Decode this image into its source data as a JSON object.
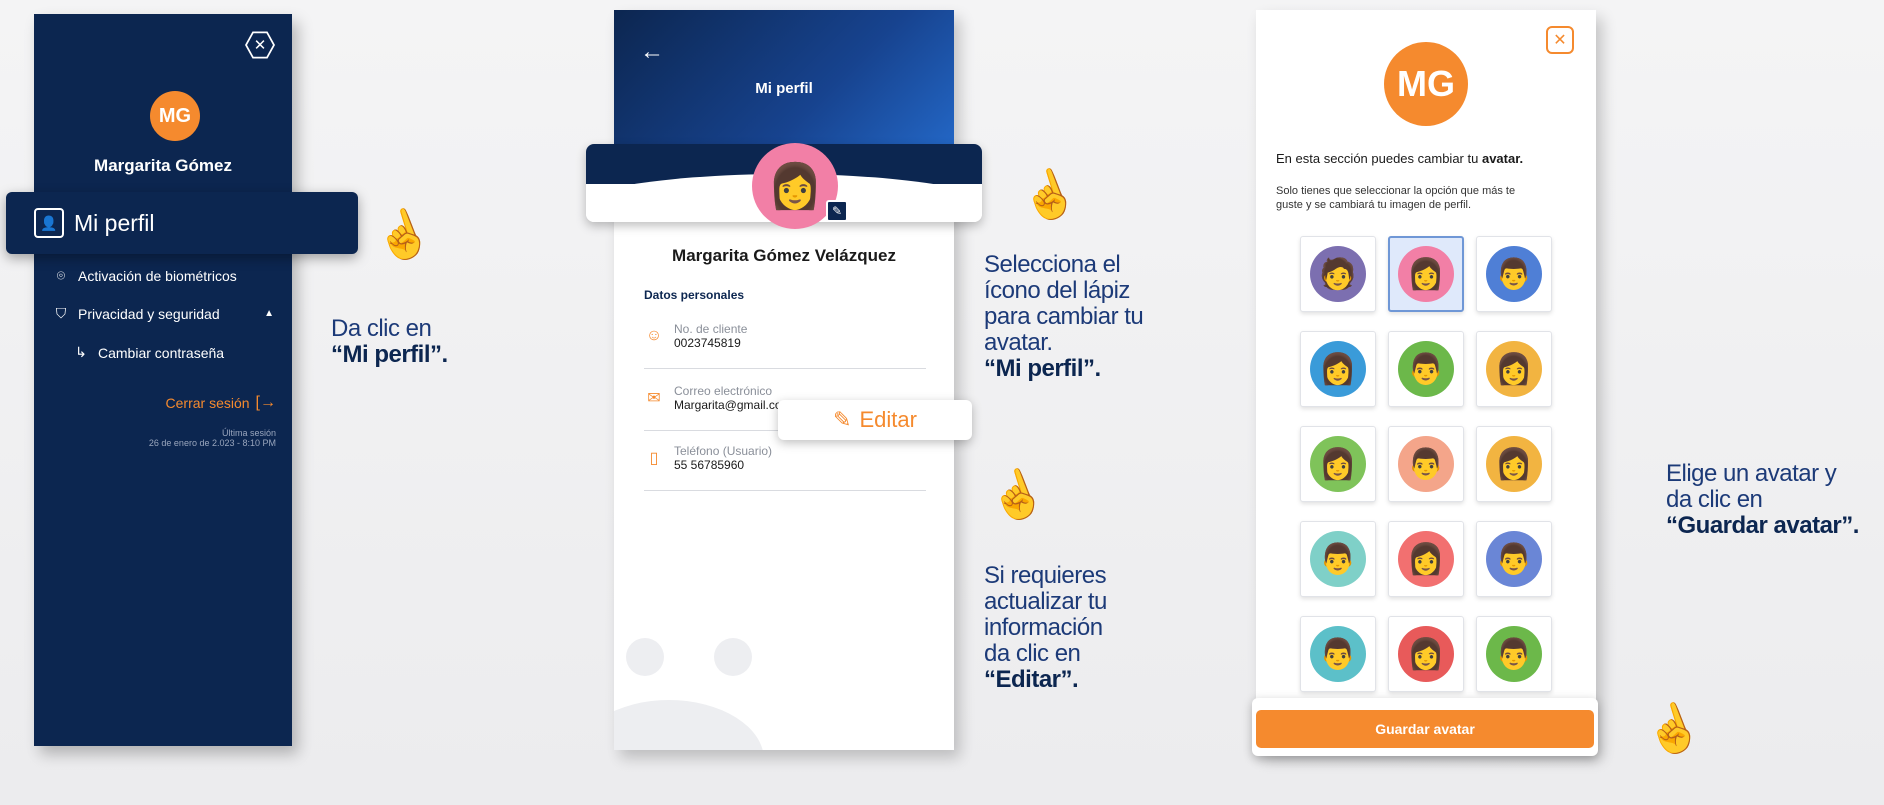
{
  "menu": {
    "avatar_initials": "MG",
    "user_name": "Margarita Gómez",
    "active_item": "Mi perfil",
    "items": [
      {
        "label": "Activación de biométricos",
        "icon": "fingerprint-icon"
      },
      {
        "label": "Privacidad y seguridad",
        "icon": "shield-icon"
      },
      {
        "label": "Cambiar contraseña",
        "icon": "return-arrow-icon"
      }
    ],
    "logout_label": "Cerrar sesión",
    "last_session_label": "Última sesión",
    "last_session_value": "26 de enero de 2.023 - 8:10 PM"
  },
  "callouts": {
    "step1_line1": "Da clic en",
    "step1_bold": "“Mi perfil”.",
    "step2_lines": [
      "Selecciona el",
      "ícono del lápiz",
      "para cambiar tu",
      "avatar."
    ],
    "step2_bold": "“Mi perfil”.",
    "step3_lines": [
      "Si requieres",
      "actualizar tu",
      "información",
      "da clic en"
    ],
    "step3_bold": "“Editar”.",
    "step4_lines": [
      "Elige un avatar y",
      "da clic en"
    ],
    "step4_bold": "“Guardar avatar”."
  },
  "profile": {
    "title": "Mi perfil",
    "full_name": "Margarita Gómez Velázquez",
    "section_title": "Datos personales",
    "fields": [
      {
        "label": "No. de cliente",
        "value": "0023745819",
        "icon": "user-circle-icon"
      },
      {
        "label": "Correo electrónico",
        "value": "Margarita@gmail.co",
        "icon": "mail-icon"
      },
      {
        "label": "Teléfono (Usuario)",
        "value": "55 56785960",
        "icon": "phone-icon"
      }
    ],
    "edit_label": "Editar"
  },
  "avatar_picker": {
    "initials": "MG",
    "intro_text": "En esta sección puedes cambiar tu",
    "intro_bold": "avatar.",
    "help_line1": "Solo tienes que seleccionar la opción que más te",
    "help_line2": "guste y se cambiará tu imagen de perfil.",
    "selected_index": 1,
    "avatar_colors": [
      "#7c6fb0",
      "#f27fa6",
      "#4f7fd6",
      "#3a9bd9",
      "#6cb84a",
      "#f2b441",
      "#7fc35a",
      "#f4a58a",
      "#f2b441",
      "#7fd0c8",
      "#f27070",
      "#6a86d6",
      "#5cc0c9",
      "#e85a5a",
      "#6cb84a"
    ],
    "save_label": "Guardar avatar"
  },
  "colors": {
    "navy": "#0c2650",
    "orange": "#f58a2e",
    "blue": "#2469c9"
  }
}
